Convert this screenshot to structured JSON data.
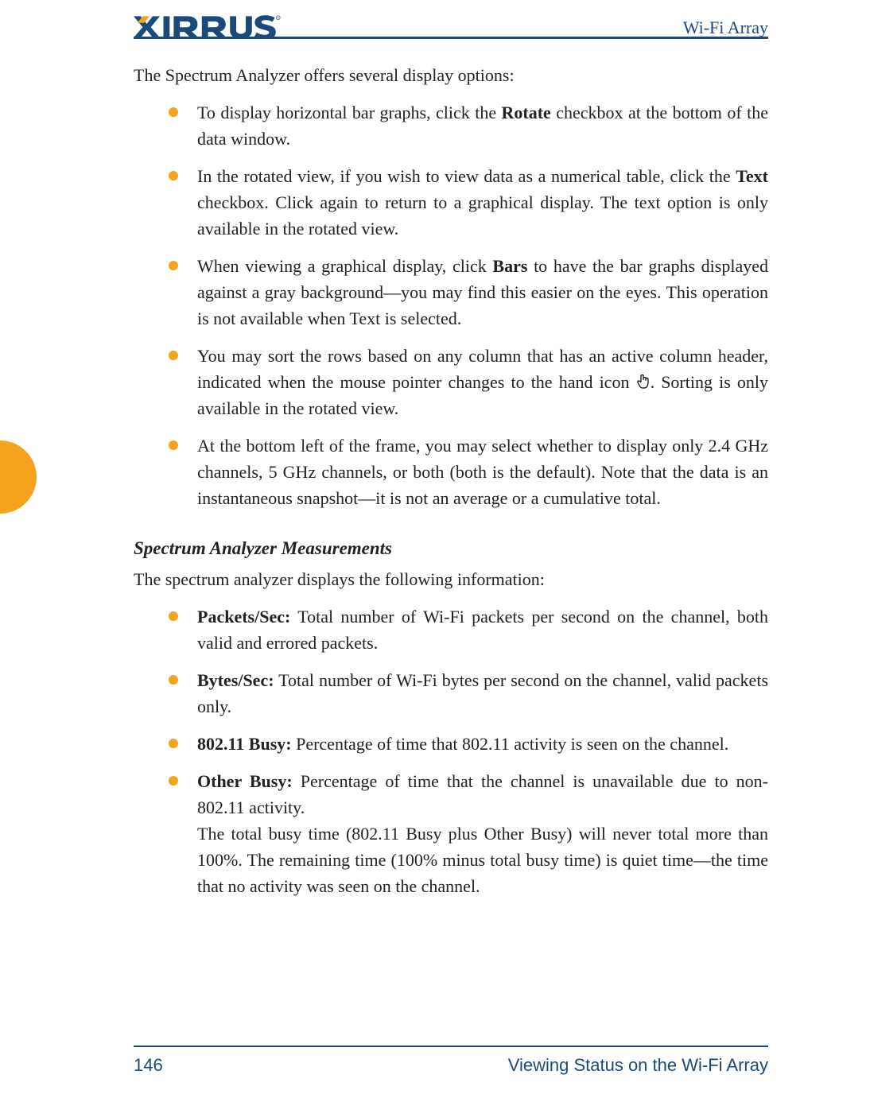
{
  "header": {
    "product": "Wi-Fi Array"
  },
  "intro": "The Spectrum Analyzer offers several display options:",
  "bullets1": [
    {
      "prefix": "To display horizontal bar graphs, click the ",
      "bold": "Rotate",
      "suffix": " checkbox at the bottom of the data window."
    },
    {
      "prefix": "In the rotated view, if you wish to view data as a numerical table, click the ",
      "bold": "Text",
      "suffix": " checkbox. Click again to return to a graphical display. The text option is only available in the rotated view."
    },
    {
      "prefix": "When viewing a graphical display, click ",
      "bold": "Bars",
      "suffix": " to have the bar graphs displayed against a gray background—you may find this easier on the eyes. This operation is not available when Text is selected."
    },
    {
      "pre_hand": "You may sort the rows based on any column that has an active column header, indicated when the mouse pointer changes to the hand icon ",
      "post_hand": ". Sorting is only available in the rotated view."
    },
    {
      "plain": "At the bottom left of the frame, you may select whether to display only 2.4 GHz channels, 5 GHz channels, or both (both is the default). Note that the data is an instantaneous snapshot—it is not an average or a cumulative total."
    }
  ],
  "subhead": "Spectrum Analyzer Measurements",
  "intro2": "The spectrum analyzer displays the following information:",
  "bullets2": [
    {
      "bold": "Packets/Sec:",
      "rest": " Total number of Wi-Fi packets per second on the channel, both valid and errored packets."
    },
    {
      "bold": "Bytes/Sec:",
      "rest": " Total number of Wi-Fi bytes per second on the channel, valid packets only."
    },
    {
      "bold": "802.11 Busy:",
      "rest": " Percentage of time that 802.11 activity is seen on the channel."
    },
    {
      "bold": "Other Busy:",
      "rest": " Percentage of time that the channel is unavailable due to non-802.11 activity."
    }
  ],
  "measure_note": "The total busy time (802.11 Busy plus Other Busy) will never total more than 100%. The remaining time (100% minus total busy time) is quiet time—the time that no activity was seen on the channel.",
  "footer": {
    "page": "146",
    "section": "Viewing Status on the Wi-Fi Array"
  }
}
